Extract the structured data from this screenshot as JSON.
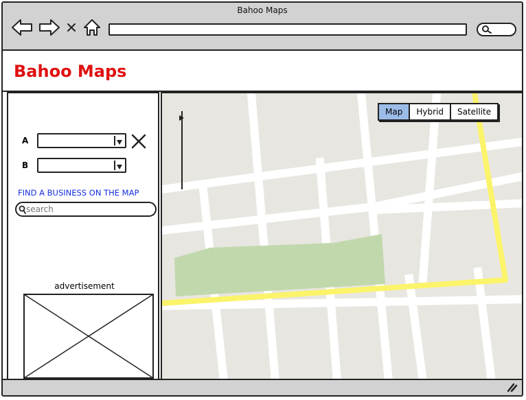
{
  "window": {
    "title": "Bahoo Maps"
  },
  "browser": {
    "url": ""
  },
  "app": {
    "title": "Bahoo Maps",
    "title_color": "#e01010"
  },
  "sidebar": {
    "route": [
      {
        "label": "A",
        "value": ""
      },
      {
        "label": "B",
        "value": ""
      }
    ],
    "find_business_label": "FIND A BUSINESS ON THE MAP",
    "search": {
      "placeholder": "search",
      "value": ""
    },
    "advertisement_label": "advertisement"
  },
  "map": {
    "types": [
      {
        "label": "Map",
        "active": true
      },
      {
        "label": "Hybrid",
        "active": false
      },
      {
        "label": "Satellite",
        "active": false
      }
    ],
    "colors": {
      "land": "#e8e6e0",
      "road": "#ffffff",
      "highway": "#fbf46a",
      "park": "#c1d8ad",
      "active_tab": "#9cbce8"
    }
  },
  "icons": [
    "back-arrow-icon",
    "forward-arrow-icon",
    "stop-icon",
    "home-icon",
    "search-icon",
    "delete-icon",
    "chevron-down-icon",
    "resize-grip-icon"
  ]
}
